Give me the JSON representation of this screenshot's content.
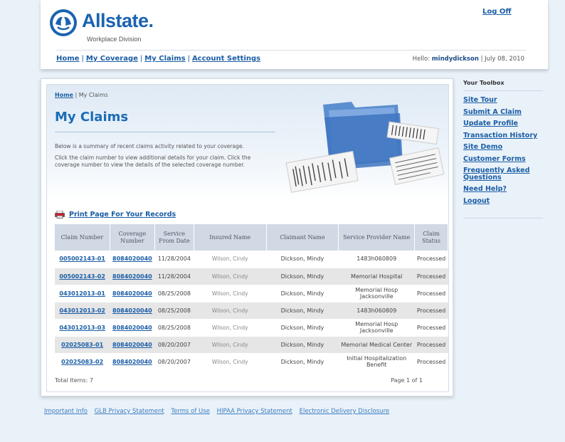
{
  "header": {
    "logo_text": "Allstate.",
    "logo_sub": "Workplace Division",
    "logoff": "Log Off",
    "nav": [
      "Home",
      "My Coverage",
      "My Claims",
      "Account Settings"
    ],
    "hello_prefix": "Hello:",
    "username": "mindydickson",
    "date": "| July 08, 2010"
  },
  "breadcrumb": {
    "home": "Home",
    "current": "| My Claims"
  },
  "page": {
    "title": "My Claims",
    "intro1": "Below is a summary of recent claims activity related to your coverage.",
    "intro2": "Click the claim number to view additional details for your claim. Click the coverage number to view the details of the selected coverage number.",
    "print": "Print Page For Your Records"
  },
  "table": {
    "headers": [
      "Claim Number",
      "Coverage Number",
      "Service From Date",
      "Insured Name",
      "Claimant Name",
      "Service Provider Name",
      "Claim Status"
    ],
    "rows": [
      [
        "005002143-01",
        "8084020040",
        "11/28/2004",
        "Wilson, Cindy",
        "Dickson, Mindy",
        "1483h060809",
        "Processed"
      ],
      [
        "005002143-02",
        "8084020040",
        "11/28/2004",
        "Wilson, Cindy",
        "Dickson, Mindy",
        "Memorial Hospital",
        "Processed"
      ],
      [
        "043012013-01",
        "8084020040",
        "08/25/2008",
        "Wilson, Cindy",
        "Dickson, Mindy",
        "Memorial Hosp Jacksonville",
        "Processed"
      ],
      [
        "043012013-02",
        "8084020040",
        "08/25/2008",
        "Wilson, Cindy",
        "Dickson, Mindy",
        "1483h060809",
        "Processed"
      ],
      [
        "043012013-03",
        "8084020040",
        "08/25/2008",
        "Wilson, Cindy",
        "Dickson, Mindy",
        "Memorial Hosp Jacksonville",
        "Processed"
      ],
      [
        "02025083-01",
        "8084020040",
        "08/20/2007",
        "Wilson, Cindy",
        "Dickson, Mindy",
        "Memorial Medical Center",
        "Processed"
      ],
      [
        "02025083-02",
        "8084020040",
        "08/20/2007",
        "Wilson, Cindy",
        "Dickson, Mindy",
        "Initial Hospitalization Benefit",
        "Processed"
      ]
    ],
    "total": "Total Items: 7",
    "page": "Page 1 of 1"
  },
  "toolbox": {
    "title": "Your Toolbox",
    "items": [
      "Site Tour",
      "Submit A Claim",
      "Update Profile",
      "Transaction History",
      "Site Demo",
      "Customer Forms",
      "Frequently Asked Questions",
      "Need Help?",
      "Logout"
    ]
  },
  "footer": {
    "links": [
      "Important Info",
      "GLB Privacy Statement",
      "Terms of Use",
      "HIPAA Privacy Statement",
      "Electronic Delivery Disclosure"
    ]
  },
  "colors": {
    "brand": "#1a63b0",
    "link": "#1a5da6",
    "table_header": "#d0d9e4",
    "row_alt": "#e6e6e6"
  },
  "icons": {
    "logo": "allstate-hands-icon",
    "print": "printer-icon",
    "hero": "folder-documents-icon"
  }
}
